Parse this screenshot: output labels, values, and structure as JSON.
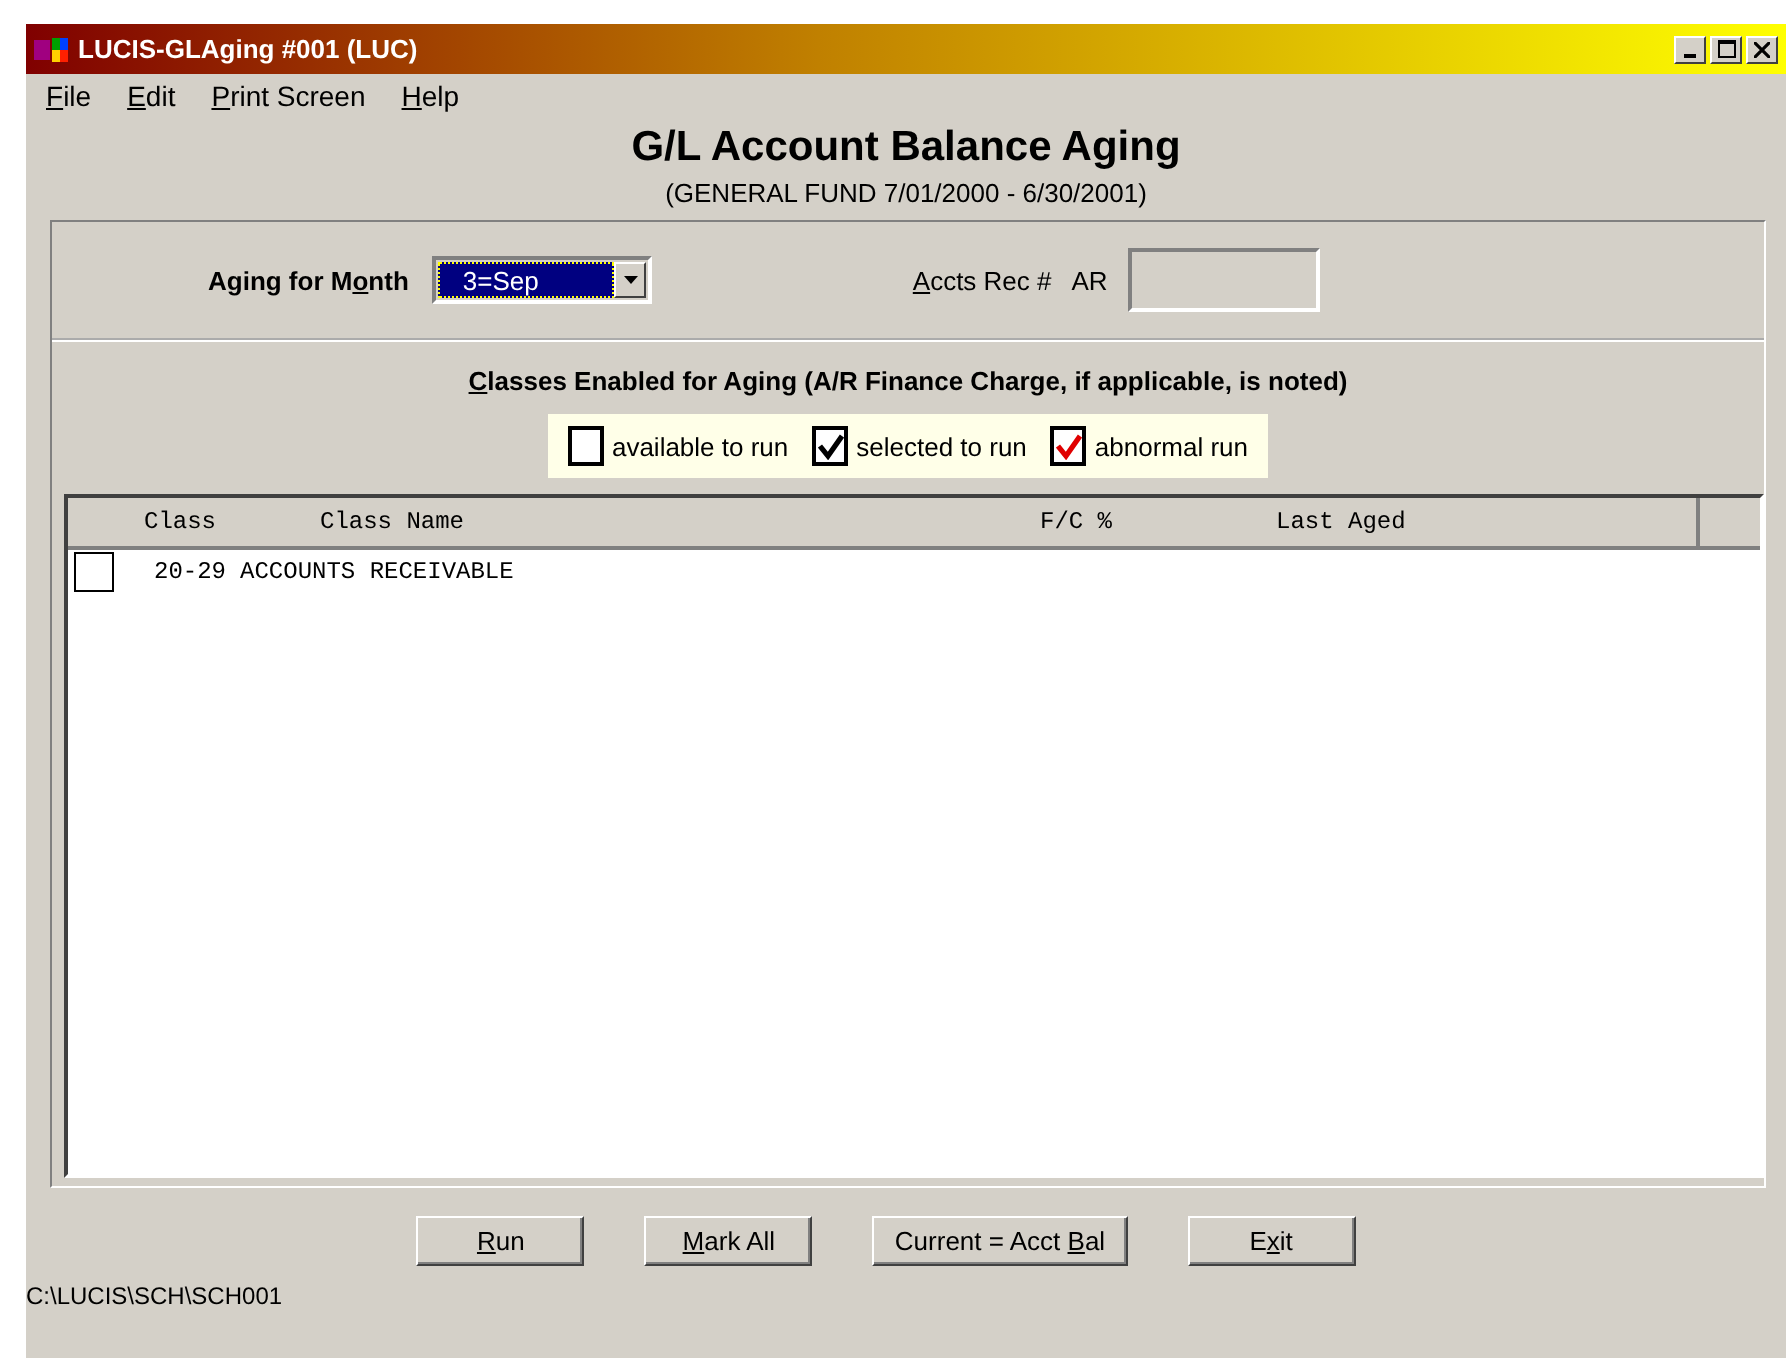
{
  "window": {
    "title": "LUCIS-GLAging #001 (LUC)"
  },
  "menu": [
    {
      "label": {
        "key": "F",
        "after": "ile"
      }
    },
    {
      "label": {
        "key": "E",
        "after": "dit"
      }
    },
    {
      "label": {
        "key": "P",
        "after": "rint Screen"
      }
    },
    {
      "label": {
        "key": "H",
        "after": "elp"
      }
    }
  ],
  "heading": "G/L Account Balance Aging",
  "subheading": "(GENERAL FUND  7/01/2000 -  6/30/2001)",
  "month": {
    "label": {
      "before": "Aging for M",
      "key": "o",
      "after": "nth"
    },
    "value": "3=Sep"
  },
  "accts_rec": {
    "label": {
      "key": "A",
      "after": "ccts Rec #"
    },
    "code": "AR"
  },
  "classes_title": {
    "key": "C",
    "after": "lasses Enabled for Aging (A/R Finance Charge, if applicable, is noted)"
  },
  "legend": [
    {
      "label": "available to run",
      "kind": "available"
    },
    {
      "label": "selected to run",
      "kind": "selected"
    },
    {
      "label": "abnormal run",
      "kind": "abnormal"
    }
  ],
  "table": {
    "columns": [
      "Class",
      "Class Name",
      "F/C %",
      "Last Aged"
    ],
    "rows": [
      {
        "checked": false,
        "class": "20-29",
        "class_name": "ACCOUNTS RECEIVABLE"
      }
    ]
  },
  "buttons": [
    {
      "label": {
        "key": "R",
        "after": "un"
      }
    },
    {
      "label": {
        "key": "M",
        "after": "ark All"
      }
    },
    {
      "label": {
        "before": "Current = Acct ",
        "key": "B",
        "after": "al"
      }
    },
    {
      "label": {
        "before": "E",
        "key": "x",
        "after": "it"
      }
    }
  ],
  "status_bar": "C:\\LUCIS\\SCH\\SCH001"
}
